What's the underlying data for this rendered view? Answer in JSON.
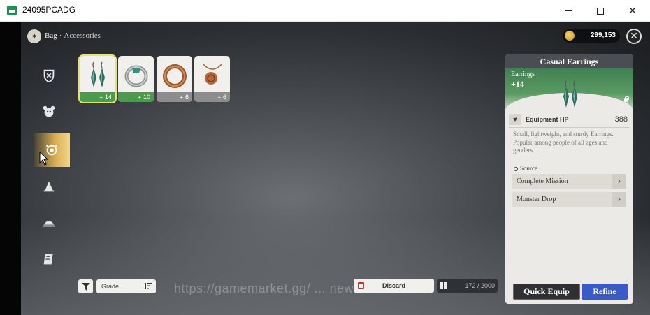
{
  "window": {
    "title": "24095PCADG"
  },
  "game": {
    "breadcrumb": {
      "section": "Bag",
      "separator": "·",
      "current": "Accessories"
    },
    "currency": {
      "icon": "coin-icon",
      "value": "299,153"
    },
    "categories": [
      {
        "name": "weapons",
        "icon": "crest-icon",
        "selected": false
      },
      {
        "name": "pets",
        "icon": "creature-icon",
        "selected": false
      },
      {
        "name": "accessories",
        "icon": "jewel-icon",
        "selected": true
      },
      {
        "name": "tools",
        "icon": "bell-icon",
        "selected": false
      },
      {
        "name": "food",
        "icon": "dish-icon",
        "selected": false
      },
      {
        "name": "materials",
        "icon": "scroll-icon",
        "selected": false
      }
    ],
    "items": [
      {
        "name": "Casual Earrings",
        "icon": "earrings-icon",
        "level": "14",
        "rarity_color": "#4c9a4c",
        "selected": true
      },
      {
        "name": "ring",
        "icon": "ring-icon",
        "level": "10",
        "rarity_color": "#4c9a4c",
        "selected": false
      },
      {
        "name": "bracelet",
        "icon": "bracelet-icon",
        "level": "6",
        "rarity_color": "#8d8d8d",
        "selected": false
      },
      {
        "name": "necklace",
        "icon": "necklace-icon",
        "level": "6",
        "rarity_color": "#8d8d8d",
        "selected": false
      }
    ],
    "level_prefix": "+",
    "bottom": {
      "grade_label": "Grade",
      "discard_label": "Discard",
      "capacity": "172 / 2000",
      "watermark": "https://gamemarket.gg/  ...  news"
    }
  },
  "detail": {
    "title": "Casual Earrings",
    "category": "Earrings",
    "level": "+14",
    "stat_name": "Equipment HP",
    "stat_value": "388",
    "description": "Small, lightweight, and sturdy Earrings. Popular among people of all ages and genders.",
    "source_label": "Source",
    "sources": [
      "Complete Mission",
      "Monster Drop"
    ],
    "quick_equip_label": "Quick Equip",
    "refine_label": "Refine",
    "accent_color": "#3a5bc7"
  }
}
